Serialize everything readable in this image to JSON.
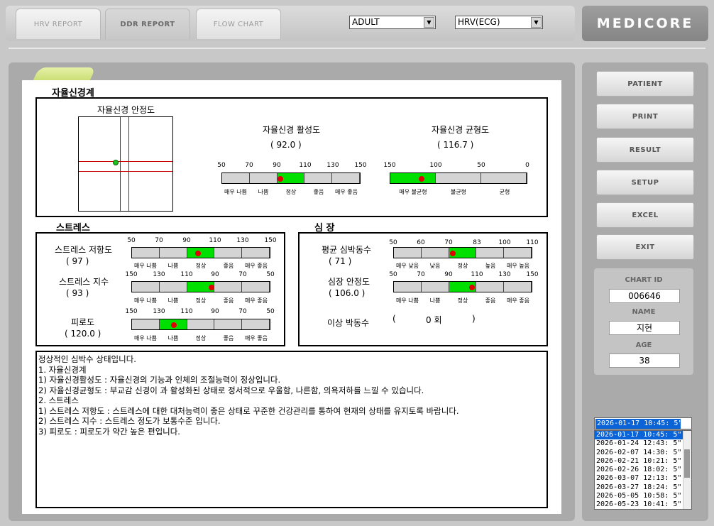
{
  "tabs": [
    {
      "label": "HRV REPORT",
      "active": false
    },
    {
      "label": "DDR REPORT",
      "active": true
    },
    {
      "label": "FLOW CHART",
      "active": false
    }
  ],
  "selects": {
    "population": "ADULT",
    "signal": "HRV(ECG)"
  },
  "brand": "MEDICORE",
  "report": {
    "ans": {
      "title": "자율신경계",
      "stability_title": "자율신경 안정도",
      "activity": {
        "title": "자율신경 활성도",
        "value": "(   92.0   )",
        "ticks": [
          "50",
          "70",
          "90",
          "110",
          "130",
          "150"
        ],
        "labels": [
          "매우 나쁨",
          "나쁨",
          "정상",
          "좋음",
          "매우 좋음"
        ]
      },
      "balance": {
        "title": "자율신경 균형도",
        "value": "(   116.7   )",
        "ticks": [
          "150",
          "100",
          "50",
          "0"
        ],
        "labels": [
          "매우 불균형",
          "불균형",
          "균형"
        ]
      }
    },
    "stress": {
      "title": "스트레스",
      "items": [
        {
          "label": "스트레스 저항도",
          "value": "(   97   )",
          "ticks": [
            "50",
            "70",
            "90",
            "110",
            "130",
            "150"
          ],
          "labels": [
            "매우 나쁨",
            "나쁨",
            "정상",
            "좋음",
            "매우 좋음"
          ]
        },
        {
          "label": "스트레스 지수",
          "value": "(   93   )",
          "ticks": [
            "150",
            "130",
            "110",
            "90",
            "70",
            "50"
          ],
          "labels": [
            "매우 나쁨",
            "나쁨",
            "정상",
            "좋음",
            "매우 좋음"
          ]
        },
        {
          "label": "피로도",
          "value": "( 120.0  )",
          "ticks": [
            "150",
            "130",
            "110",
            "90",
            "70",
            "50"
          ],
          "labels": [
            "매우 나쁨",
            "나쁨",
            "정상",
            "좋음",
            "매우 좋음"
          ]
        }
      ]
    },
    "heart": {
      "title": "심 장",
      "items": [
        {
          "label": "평균 심박동수",
          "value": "(   71   )",
          "ticks": [
            "50",
            "60",
            "70",
            "83",
            "100",
            "110"
          ],
          "labels": [
            "매우 낮음",
            "낮음",
            "정상",
            "높음",
            "매우 높음"
          ]
        },
        {
          "label": "심장 안정도",
          "value": "( 106.0  )",
          "ticks": [
            "50",
            "70",
            "90",
            "110",
            "130",
            "150"
          ],
          "labels": [
            "매우 나쁨",
            "나쁨",
            "정상",
            "좋음",
            "매우 좋음"
          ]
        }
      ],
      "arrhythmia": {
        "label": "이상 박동수",
        "open": "(",
        "value": "0 회",
        "close": ")"
      }
    },
    "comments": [
      "정상적인 심박수 상태입니다.",
      "1. 자율신경계",
      " 1) 자율신경활성도 : 자율신경의 기능과 인체의 조절능력이 정상입니다.",
      " 2) 자율신경균형도 : 부교감 신경이 과 활성화된 상태로 정서적으로 우울함, 나른함, 의욕저하를 느낄 수 있습니다.",
      "2. 스트레스",
      " 1) 스트레스 저항도 : 스트레스에 대한 대처능력이 좋은 상태로 꾸준한 건강관리를 통하여 현재의 상태를 유지토록 바랍니다.",
      " 2) 스트레스 지수 : 스트레스 정도가 보통수준 입니다.",
      " 3) 피로도 : 피로도가 약간 높은 편입니다."
    ]
  },
  "sidebar": {
    "buttons": [
      "PATIENT",
      "PRINT",
      "RESULT",
      "SETUP",
      "EXCEL",
      "EXIT"
    ],
    "chart_id_label": "CHART ID",
    "chart_id": "006646",
    "name_label": "NAME",
    "name": "지현",
    "age_label": "AGE",
    "age": "38",
    "selected_record": "2026-01-17 10:45:  5\"",
    "records": [
      "2026-01-17 10:45:  5\"",
      "2026-01-24 12:43:  5\"",
      "2026-02-07 14:30:  5\"",
      "2026-02-21 10:21:  5\"",
      "2026-02-26 18:02:  5\"",
      "2026-03-07 12:13:  5\"",
      "2026-03-27 18:24:  5\"",
      "2026-05-05 10:58:  5\"",
      "2026-05-23 10:41:  5\""
    ]
  }
}
